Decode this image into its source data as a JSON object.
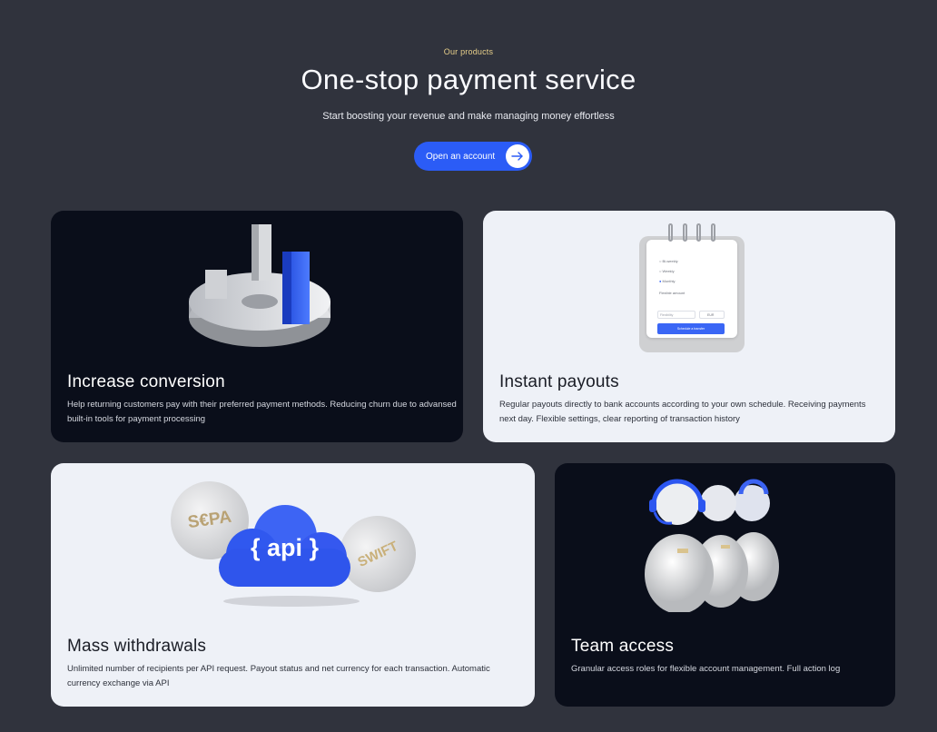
{
  "hero": {
    "eyebrow": "Our products",
    "title": "One-stop payment service",
    "subtitle": "Start boosting your revenue and make managing money effortless",
    "cta_label": "Open an account",
    "cta_icon": "arrow-right-icon"
  },
  "colors": {
    "background": "#30333d",
    "dark_card": "#0a0e1a",
    "light_card": "#eef1f7",
    "accent": "#2b5cf6",
    "eyebrow": "#e7cf8a"
  },
  "cards": [
    {
      "title": "Increase conversion",
      "description": "Help returning customers pay with their preferred payment methods. Reducing churn due to advansed built-in tools for payment processing",
      "illustration": "pie-bar-chart-illustration"
    },
    {
      "title": "Instant payouts",
      "description": "Regular payouts directly to bank accounts according to your own schedule. Receiving payments next day. Flexible settings, clear reporting of transaction history",
      "illustration": "notepad-schedule-illustration",
      "notepad": {
        "options": [
          "Bi-weekly",
          "Weekly",
          "Monthly"
        ],
        "field_label": "Flexible amount",
        "amount_placeholder": "Flexibility",
        "currency": "EUR",
        "button": "Schedule a transfer"
      }
    },
    {
      "title": "Mass withdrawals",
      "description": "Unlimited number of recipients per API request. Payout status and net currency for each transaction. Automatic currency exchange via API",
      "illustration": "api-cloud-coins-illustration",
      "badges": {
        "coin_left": "S€PA",
        "cloud": "{ api }",
        "coin_right": "SWIFT"
      }
    },
    {
      "title": "Team access",
      "description": "Granular access roles for flexible account management. Full action log",
      "illustration": "team-figures-illustration"
    }
  ]
}
